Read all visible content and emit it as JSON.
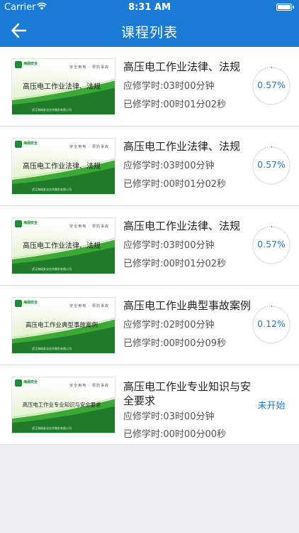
{
  "status_bar": {
    "carrier": "Carrier",
    "time": "8:31 AM"
  },
  "nav": {
    "title": "课程列表",
    "back_icon": "arrow-left-icon"
  },
  "colors": {
    "accent": "#1a7ad4",
    "thumb_green": "#3aa935",
    "thumb_dark": "#1f7a2a"
  },
  "thumb_labels": {
    "logo": "海阔安全",
    "slogan": "安全用电 · 预防事故",
    "company": "武汉海阔安全技术服务有限公司"
  },
  "courses": [
    {
      "thumb_title": "高压电工作业法律、法规",
      "name": "高压电工作业法律、法规",
      "required": "应修学时:03时00分钟",
      "completed": "已修学时:00时01分02秒",
      "progress": 0.57,
      "progress_label": "0.57%"
    },
    {
      "thumb_title": "高压电工作业法律、法规",
      "name": "高压电工作业法律、法规",
      "required": "应修学时:03时00分钟",
      "completed": "已修学时:00时01分02秒",
      "progress": 0.57,
      "progress_label": "0.57%"
    },
    {
      "thumb_title": "高压电工作业法律、法规",
      "name": "高压电工作业法律、法规",
      "required": "应修学时:03时00分钟",
      "completed": "已修学时:00时01分02秒",
      "progress": 0.57,
      "progress_label": "0.57%"
    },
    {
      "thumb_title": "高压电工作业典型事故案例",
      "name": "高压电工作业典型事故案例",
      "required": "应修学时:02时00分钟",
      "completed": "已修学时:00时00分09秒",
      "progress": 0.12,
      "progress_label": "0.12%"
    },
    {
      "thumb_title": "高压电工作业专业知识与安全要求",
      "name": "高压电工作业专业知识与安全要求",
      "required": "应修学时:03时00分钟",
      "completed": "已修学时:00时00分00秒",
      "status": "未开始"
    }
  ]
}
